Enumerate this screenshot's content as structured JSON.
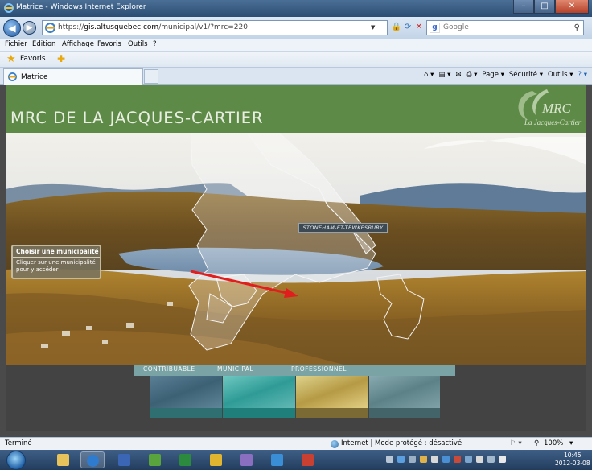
{
  "window": {
    "title": "Matrice - Windows Internet Explorer",
    "controls": {
      "minimize": "–",
      "maximize": "□",
      "close": "✕"
    }
  },
  "address_bar": {
    "url_prefix": "https://",
    "url_domain": "gis.altusquebec.com",
    "url_path": "/municipal/v1/?mrc=220",
    "search_placeholder": "Google"
  },
  "menu": [
    "Fichier",
    "Edition",
    "Affichage",
    "Favoris",
    "Outils",
    "?"
  ],
  "favorites": {
    "label": "Favoris"
  },
  "tab": {
    "label": "Matrice"
  },
  "command_bar": {
    "page": "Page ▾",
    "security": "Sécurité ▾",
    "tools": "Outils ▾"
  },
  "page": {
    "banner_title": "MRC DE LA JACQUES-CARTIER",
    "logo_text": "MRC",
    "logo_subtext": "La Jacques-Cartier",
    "choose_panel": {
      "heading": "Choisir une municipalité",
      "body": "Cliquer sur une municipalité pour y accéder"
    },
    "hover_label": "STONEHAM-ET-TEWKESBURY",
    "tiles": [
      {
        "label": "CONTRIBUABLE"
      },
      {
        "label": "MUNICIPAL"
      },
      {
        "label": "PROFESSIONNEL"
      },
      {
        "label": ""
      }
    ]
  },
  "status_bar": {
    "left": "Terminé",
    "zone": "Internet | Mode protégé : désactivé",
    "zoom": "100%"
  },
  "taskbar": {
    "clock_time": "10:45",
    "clock_date": "2012-03-08"
  },
  "colors": {
    "banner": "#5e8a47",
    "annotation_arrow": "#e21d1d"
  }
}
